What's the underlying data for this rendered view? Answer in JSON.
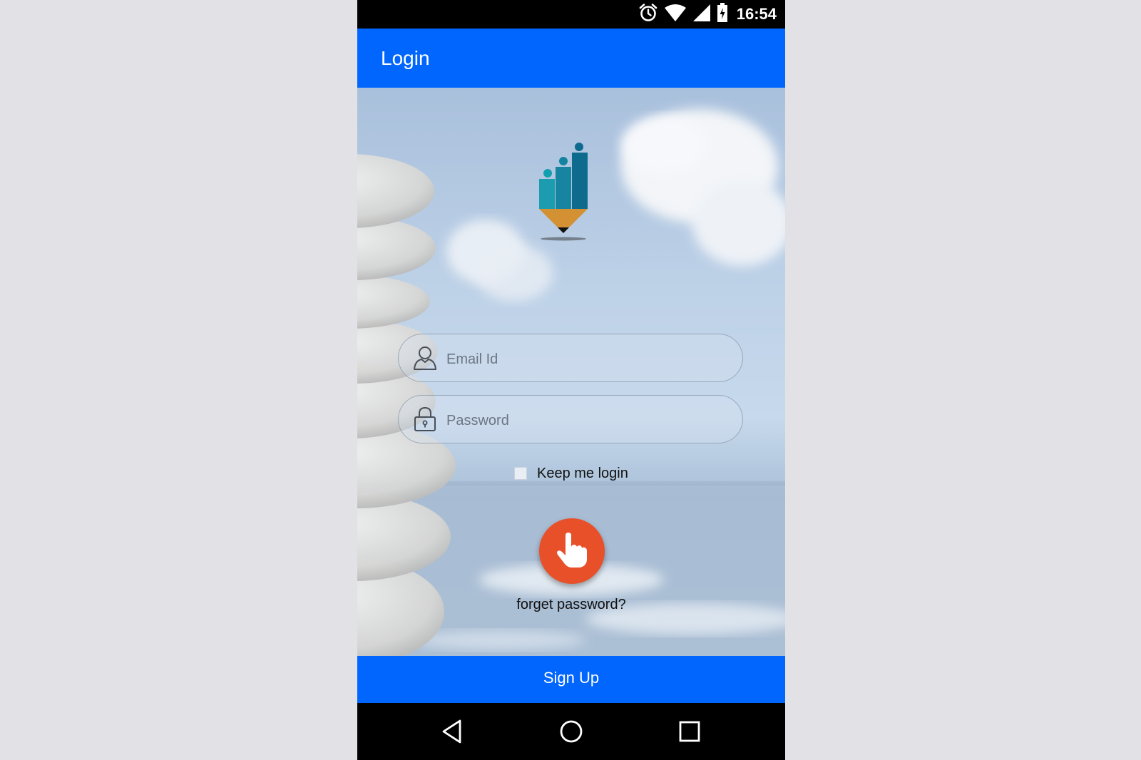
{
  "status_bar": {
    "time": "16:54",
    "icons": [
      "alarm-icon",
      "wifi-icon",
      "signal-icon",
      "battery-icon"
    ]
  },
  "app_bar": {
    "title": "Login"
  },
  "form": {
    "email": {
      "placeholder": "Email Id",
      "value": "",
      "icon": "user-icon"
    },
    "password": {
      "placeholder": "Password",
      "value": "",
      "icon": "lock-icon"
    },
    "keep_login": {
      "label": "Keep me login",
      "checked": false
    },
    "login_button_icon": "hand-pointer-icon",
    "forgot_password": "forget password?"
  },
  "signup": {
    "label": "Sign Up"
  },
  "nav_bar": {
    "icons": [
      "back-icon",
      "home-icon",
      "recents-icon"
    ]
  },
  "colors": {
    "primary": "#0066fe",
    "accent": "#e8502a",
    "page_background": "#e2e1e6"
  }
}
